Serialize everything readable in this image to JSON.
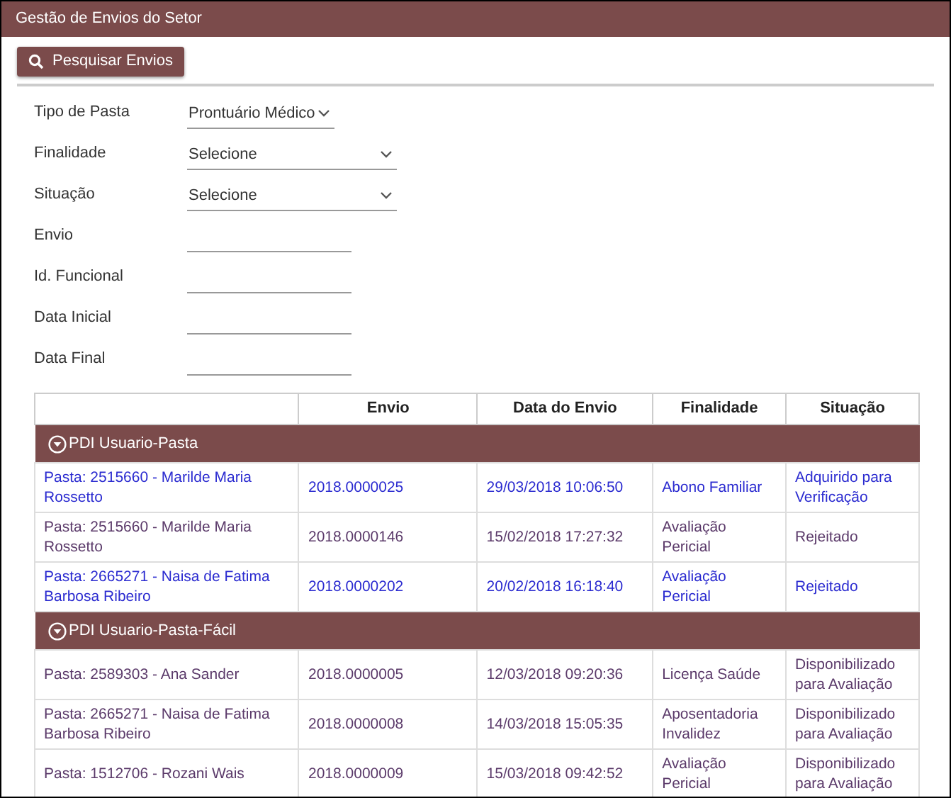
{
  "window": {
    "title": "Gestão de Envios do Setor"
  },
  "search_button": {
    "label": "Pesquisar Envios"
  },
  "form": [
    {
      "kind": "short-select",
      "label": "Tipo de Pasta",
      "value": "Prontuário Médico"
    },
    {
      "kind": "select",
      "label": "Finalidade",
      "value": "Selecione"
    },
    {
      "kind": "select",
      "label": "Situação",
      "value": "Selecione"
    },
    {
      "kind": "text",
      "label": "Envio"
    },
    {
      "kind": "text",
      "label": "Id. Funcional"
    },
    {
      "kind": "text",
      "label": "Data Inicial"
    },
    {
      "kind": "text",
      "label": "Data Final"
    }
  ],
  "table": {
    "columns": [
      "Envio",
      "Data do Envio",
      "Finalidade",
      "Situação"
    ],
    "groups": [
      {
        "title": "PDI Usuario-Pasta",
        "expanded": true,
        "rows": [
          {
            "visited": false,
            "cells": [
              "Pasta: 2515660 - Marilde Maria Rossetto",
              "2018.0000025",
              "29/03/2018 10:06:50",
              "Abono Familiar",
              "Adquirido para Verificação"
            ]
          },
          {
            "visited": true,
            "cells": [
              "Pasta: 2515660 - Marilde Maria Rossetto",
              "2018.0000146",
              "15/02/2018 17:27:32",
              "Avaliação Pericial",
              "Rejeitado"
            ]
          },
          {
            "visited": false,
            "cells": [
              "Pasta: 2665271 - Naisa de Fatima Barbosa Ribeiro",
              "2018.0000202",
              "20/02/2018 16:18:40",
              "Avaliação Pericial",
              "Rejeitado"
            ]
          }
        ]
      },
      {
        "title": "PDI Usuario-Pasta-Fácil",
        "expanded": true,
        "rows": [
          {
            "visited": true,
            "cells": [
              "Pasta: 2589303 - Ana Sander",
              "2018.0000005",
              "12/03/2018 09:20:36",
              "Licença Saúde",
              "Disponibilizado para Avaliação"
            ]
          },
          {
            "visited": true,
            "cells": [
              "Pasta: 2665271 - Naisa de Fatima Barbosa Ribeiro",
              "2018.0000008",
              "14/03/2018 15:05:35",
              "Aposentadoria Invalidez",
              "Disponibilizado para Avaliação"
            ]
          },
          {
            "visited": true,
            "cells": [
              "Pasta: 1512706 - Rozani Wais",
              "2018.0000009",
              "15/03/2018 09:42:52",
              "Avaliação Pericial",
              "Disponibilizado para Avaliação"
            ]
          }
        ]
      }
    ]
  }
}
